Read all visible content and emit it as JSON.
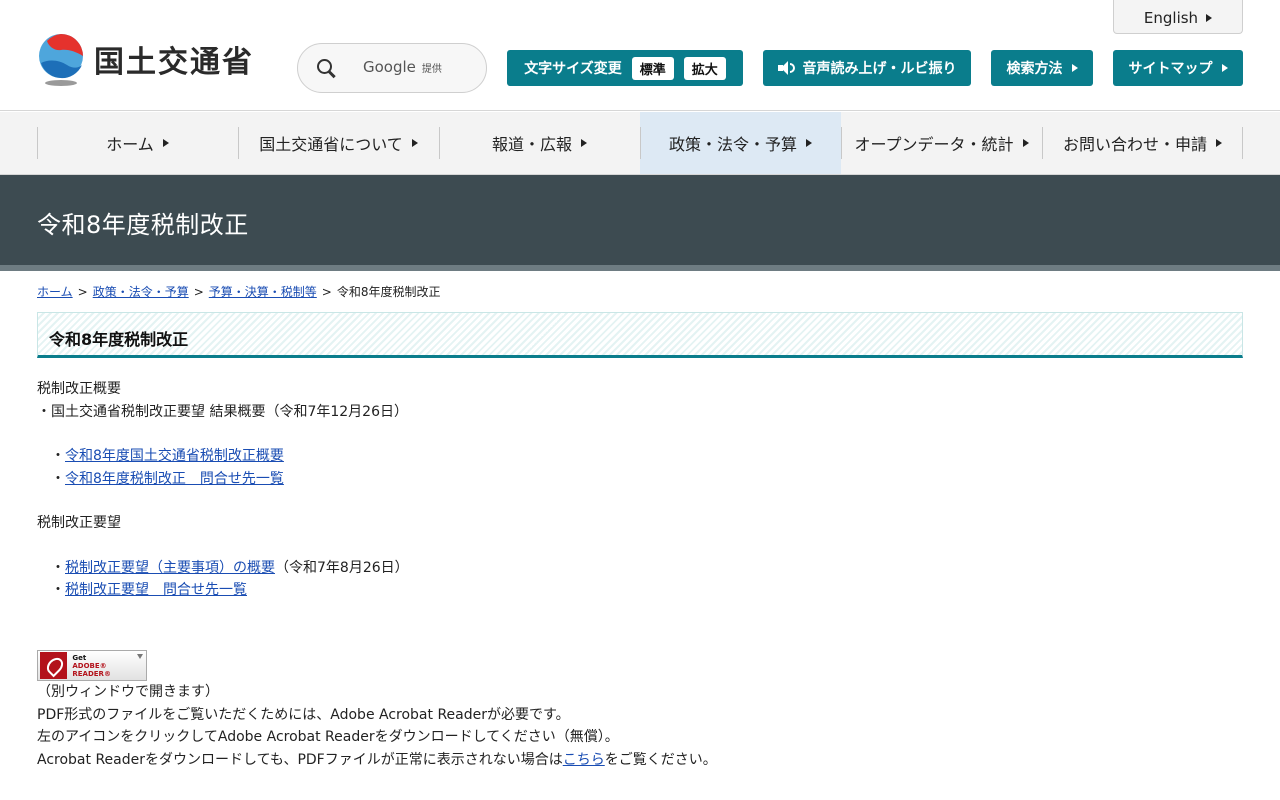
{
  "header": {
    "logo_text": "国土交通省",
    "english_label": "English",
    "search": {
      "placeholder": "",
      "google_label": "Google",
      "google_suffix": "提供"
    },
    "font_size": {
      "label": "文字サイズ変更",
      "standard": "標準",
      "large": "拡大"
    },
    "speech_label": "音声読み上げ・ルビ振り",
    "search_method_label": "検索方法",
    "sitemap_label": "サイトマップ"
  },
  "nav": {
    "items": [
      {
        "label": "ホーム"
      },
      {
        "label": "国土交通省について"
      },
      {
        "label": "報道・広報"
      },
      {
        "label": "政策・法令・予算"
      },
      {
        "label": "オープンデータ・統計"
      },
      {
        "label": "お問い合わせ・申請"
      }
    ]
  },
  "page_title": "令和8年度税制改正",
  "breadcrumb": {
    "home": "ホーム",
    "policy": "政策・法令・予算",
    "budget": "予算・決算・税制等",
    "current": "令和8年度税制改正",
    "sep": ">"
  },
  "section_heading": "令和8年度税制改正",
  "content": {
    "overview_heading": "税制改正概要",
    "overview_result": "・国土交通省税制改正要望 結果概要（令和7年12月26日）",
    "bullet": "・",
    "overview_links": [
      "令和8年度国土交通省税制改正概要",
      "令和8年度税制改正　問合せ先一覧"
    ],
    "request_heading": "税制改正要望",
    "request_link1": "税制改正要望（主要事項）の概要",
    "request_link1_suffix": "（令和7年8月26日）",
    "request_link2": "税制改正要望　問合せ先一覧"
  },
  "adobe": {
    "line1": "Get",
    "line2": "ADOBE® READER®"
  },
  "pdf_note": {
    "line1": "（別ウィンドウで開きます）",
    "line2": "PDF形式のファイルをご覧いただくためには、Adobe Acrobat Readerが必要です。",
    "line3": "左のアイコンをクリックしてAdobe Acrobat Readerをダウンロードしてください（無償）。",
    "line4_pre": "Acrobat Readerをダウンロードしても、PDFファイルが正常に表示されない場合は",
    "line4_link": "こちら",
    "line4_post": "をご覧ください。"
  },
  "colors": {
    "accent": "#0a7d8c",
    "title_band": "#3d4b51",
    "link": "#1a4db3",
    "nav_active": "#dde9f4"
  }
}
